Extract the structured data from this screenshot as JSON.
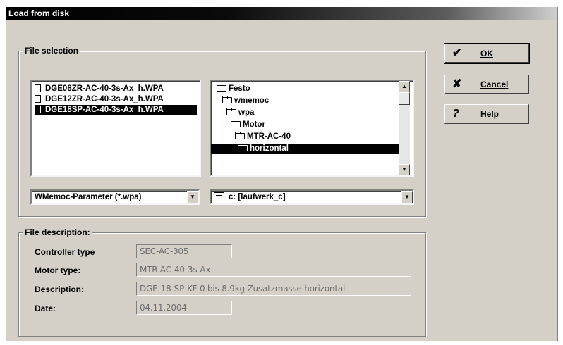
{
  "window": {
    "title": "Load from disk"
  },
  "file_selection": {
    "label": "File selection",
    "files": [
      {
        "name": "DGE08ZR-AC-40-3s-Ax_h.WPA",
        "selected": false
      },
      {
        "name": "DGE12ZR-AC-40-3s-Ax_h.WPA",
        "selected": false
      },
      {
        "name": "DGE18SP-AC-40-3s-Ax_h.WPA",
        "selected": true
      }
    ],
    "folders": [
      {
        "name": "Festo",
        "selected": false
      },
      {
        "name": "wmemoc",
        "selected": false
      },
      {
        "name": "wpa",
        "selected": false
      },
      {
        "name": "Motor",
        "selected": false
      },
      {
        "name": "MTR-AC-40",
        "selected": false
      },
      {
        "name": "horizontal",
        "selected": true
      }
    ],
    "file_type": "WMemoc-Parameter (*.wpa)",
    "drive": "c: [laufwerk_c]"
  },
  "buttons": {
    "ok": {
      "label": "OK",
      "icon": "checkmark-icon"
    },
    "cancel": {
      "label": "Cancel",
      "icon": "x-icon"
    },
    "help": {
      "label": "Help",
      "icon": "question-icon"
    }
  },
  "file_description": {
    "label": "File description:",
    "controller_type_label": "Controller type",
    "controller_type": "SEC-AC-305",
    "motor_type_label": "Motor type:",
    "motor_type": "MTR-AC-40-3s-Ax",
    "description_label": "Description:",
    "description": "DGE-18-SP-KF   0 bis 8.9kg Zusatzmasse horizontal",
    "date_label": "Date:",
    "date": "04.11.2004"
  }
}
